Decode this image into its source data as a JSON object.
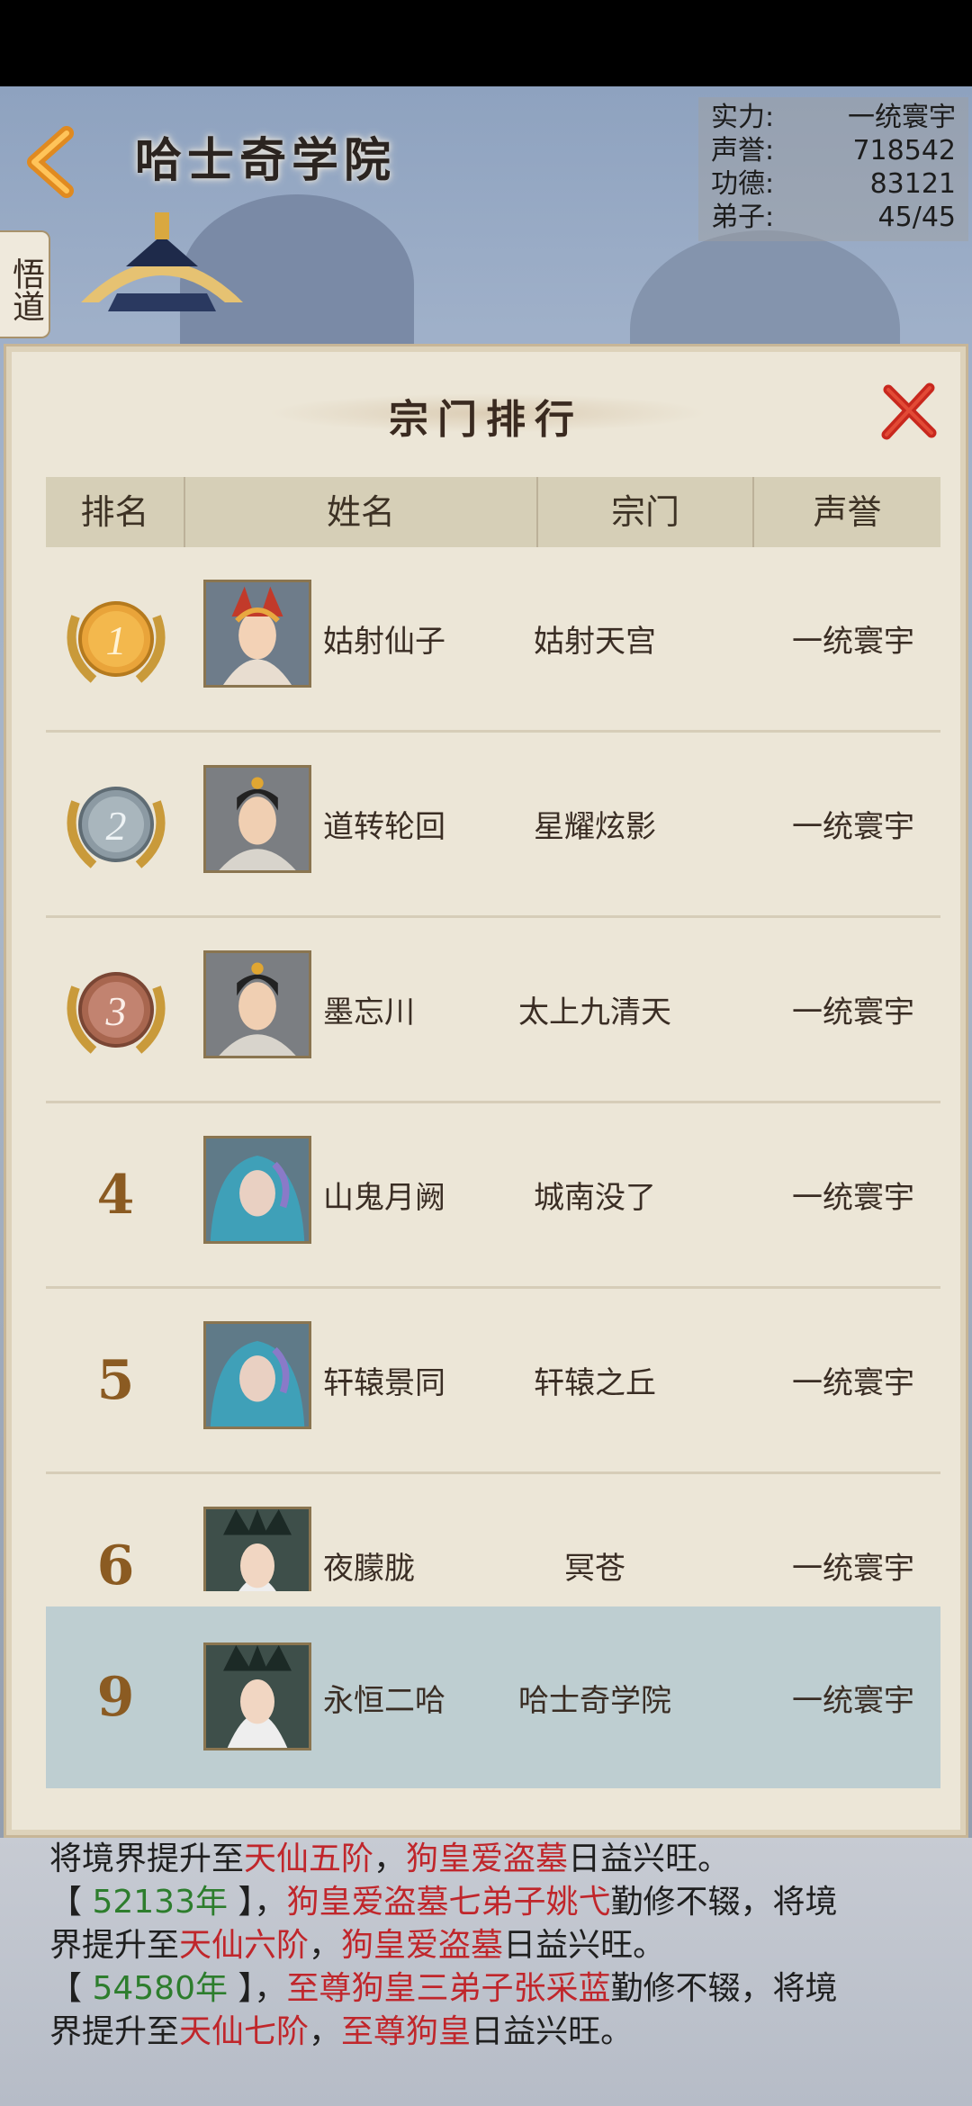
{
  "header": {
    "academy_name": "哈士奇学院",
    "side_tab": "悟道"
  },
  "stats": [
    {
      "label": "实力:",
      "value": "一统寰宇"
    },
    {
      "label": "声誉:",
      "value": "718542"
    },
    {
      "label": "功德:",
      "value": "83121"
    },
    {
      "label": "弟子:",
      "value": "45/45"
    }
  ],
  "modal": {
    "title": "宗门排行",
    "columns": [
      "排名",
      "姓名",
      "宗门",
      "声誉"
    ]
  },
  "rows": [
    {
      "rank": "1",
      "name": "姑射仙子",
      "sect": "姑射天宫",
      "fame": "一统寰宇"
    },
    {
      "rank": "2",
      "name": "道转轮回",
      "sect": "星耀炫影",
      "fame": "一统寰宇"
    },
    {
      "rank": "3",
      "name": "墨忘川",
      "sect": "太上九清天",
      "fame": "一统寰宇"
    },
    {
      "rank": "4",
      "name": "山鬼月阙",
      "sect": "城南没了",
      "fame": "一统寰宇"
    },
    {
      "rank": "5",
      "name": "轩辕景同",
      "sect": "轩辕之丘",
      "fame": "一统寰宇"
    },
    {
      "rank": "6",
      "name": "夜朦胧",
      "sect": "冥苍",
      "fame": "一统寰宇"
    }
  ],
  "self_row": {
    "rank": "9",
    "name": "永恒二哈",
    "sect": "哈士奇学院",
    "fame": "一统寰宇"
  },
  "log": {
    "l1": [
      "将境界提升至",
      "天仙五阶",
      "，",
      "狗皇爱盗墓",
      "日益兴旺。"
    ],
    "l2": [
      "【 ",
      "52133年",
      " 】，",
      "狗皇爱盗墓七弟子姚弋",
      "勤修不辍，将境"
    ],
    "l3": [
      "界提升至",
      "天仙六阶",
      "，",
      "狗皇爱盗墓",
      "日益兴旺。"
    ],
    "l4": [
      "【 ",
      "54580年",
      " 】，",
      "至尊狗皇三弟子张采蓝",
      "勤修不辍，将境"
    ],
    "l5": [
      "界提升至",
      "天仙七阶",
      "，",
      "至尊狗皇",
      "日益兴旺。"
    ]
  },
  "colors": {
    "accent_red": "#c0262b",
    "year_green": "#2d7d2d",
    "rank_brown": "#8b5b22"
  }
}
